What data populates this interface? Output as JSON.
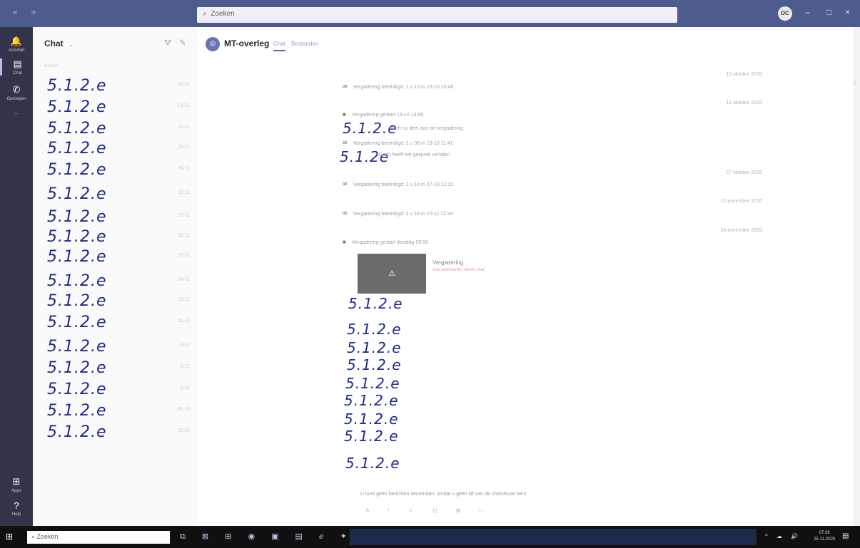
{
  "topbar": {
    "nav": "< >",
    "search_placeholder": "Zoeken",
    "avatar_initials": "DC",
    "min": "–",
    "max": "□",
    "close": "×"
  },
  "rail": {
    "activity": "Activiteit",
    "chat": "Chat",
    "calls": "Oproepen",
    "more": "...",
    "apps": "Apps",
    "help": "Help"
  },
  "chatlist": {
    "header": "Chat",
    "chevron": "⌄",
    "recent_label": "Recent",
    "items": [
      {
        "name": "5.1.2.e",
        "time": "14:11"
      },
      {
        "name": "5.1.2.e",
        "time": "13:51"
      },
      {
        "name": "5.1.2.e",
        "time": "11:11"
      },
      {
        "name": "5.1.2.e",
        "time": "24.11"
      },
      {
        "name": "5.1.2.e",
        "time": "24.11"
      },
      {
        "name": "5.1.2.e",
        "time": "23.11"
      },
      {
        "name": "5.1.2.e",
        "time": "22.11"
      },
      {
        "name": "5.1.2.e",
        "time": "18.11"
      },
      {
        "name": "5.1.2.e",
        "time": "16.11"
      },
      {
        "name": "5.1.2.e",
        "time": "14.11"
      },
      {
        "name": "5.1.2.e",
        "time": "13.11"
      },
      {
        "name": "5.1.2.e",
        "time": "11.11"
      },
      {
        "name": "5.1.2.e",
        "time": "9.11"
      },
      {
        "name": "5.1.2.e",
        "time": "3.11"
      },
      {
        "name": "5.1.2.e",
        "time": "2.11"
      },
      {
        "name": "5.1.2.e",
        "time": "30.10"
      },
      {
        "name": "5.1.2.e",
        "time": "28.10"
      }
    ]
  },
  "conversation": {
    "title": "MT-overleg",
    "tabs": [
      "Chat",
      "Bestanden"
    ],
    "messages": [
      {
        "icon": "✉",
        "text": "Vergadering beeindigd: 1 u 13 m   13-10 13:46"
      },
      {
        "icon": "■",
        "text": "Vergadering gestart   13-10 13:06"
      },
      {
        "icon": "✉",
        "text": "heeft nu deel aan de vergadering"
      },
      {
        "icon": "✉",
        "text": "Vergadering beeindigd: 1 u 35 m   13-10 11:41"
      },
      {
        "icon": "",
        "text": "(Gast) heeft het gesprek verlaten"
      },
      {
        "icon": "✉",
        "text": "Vergadering beeindigd: 2 u 14 m   27-10 12:15"
      },
      {
        "icon": "✉",
        "text": "Vergadering beeindigd: 2 u 18 m   10-11 12:34"
      },
      {
        "icon": "■",
        "text": "Vergadering gestart   dinsdag 09:59"
      }
    ],
    "dates": [
      "13 oktober 2020",
      "13 oktober 2020",
      "27 oktober 2020",
      "10 november 2020",
      "24 november 2020"
    ],
    "handwritten_inline": [
      "5.1.2.e",
      "5.1.2e"
    ],
    "handwritten_list": [
      "5.1.2.e",
      "5.1.2.e",
      "5.1.2.e",
      "5.1.2.e",
      "5.1.2.e",
      "5.1.2.e",
      "5.1.2.e",
      "5.1.2.e",
      "5.1.2.e"
    ],
    "meeting_card_icon": "⚠",
    "meeting_title": "Vergadering",
    "meeting_sub": "Aan deelnemen via de chat",
    "footer_note": "U kunt geen berichten verzenden, omdat u geen lid van de chatsessie bent.",
    "footer_tools": "A ! ☺ ⊡ ⊞ ▷"
  },
  "taskbar": {
    "start": "⊞",
    "search_placeholder": "Zoeken",
    "apps": "⧉ ⊠ ⊞ ◉ ▣ ▤ ℯ ✦",
    "tray": "^ ☁ 🔊",
    "time": "07:39",
    "date": "25-11-2020",
    "notif": "▤"
  }
}
